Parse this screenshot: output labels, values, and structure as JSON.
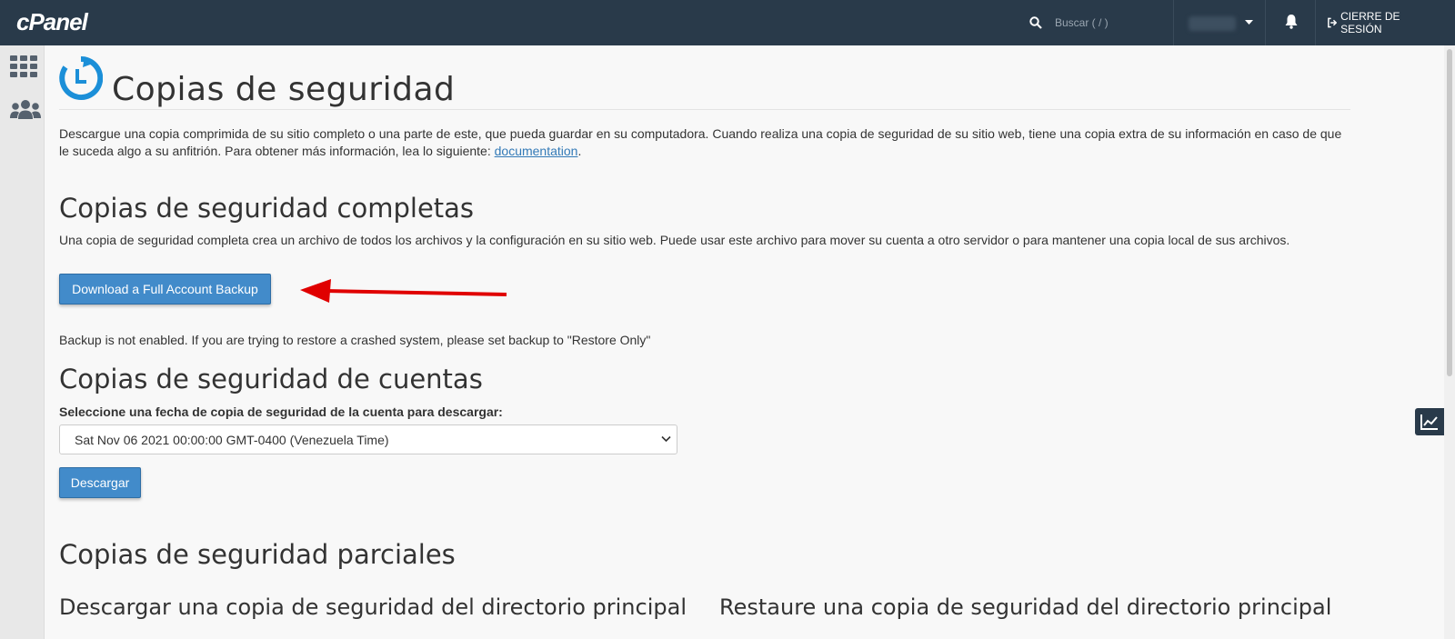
{
  "topbar": {
    "logo": "cPanel",
    "search_placeholder": "Buscar ( / )",
    "logout_label": "CIERRE DE SESIÓN"
  },
  "page": {
    "title": "Copias de seguridad",
    "intro_text": "Descargue una copia comprimida de su sitio completo o una parte de este, que pueda guardar en su computadora. Cuando realiza una copia de seguridad de su sitio web, tiene una copia extra de su información en caso de que le suceda algo a su anfitrión. Para obtener más información, lea lo siguiente: ",
    "intro_link": "documentation",
    "intro_end": "."
  },
  "full_backups": {
    "heading": "Copias de seguridad completas",
    "description": "Una copia de seguridad completa crea un archivo de todos los archivos y la configuración en su sitio web. Puede usar este archivo para mover su cuenta a otro servidor o para mantener una copia local de sus archivos.",
    "button_label": "Download a Full Account Backup",
    "notice": "Backup is not enabled. If you are trying to restore a crashed system, please set backup to \"Restore Only\""
  },
  "account_backups": {
    "heading": "Copias de seguridad de cuentas",
    "select_label": "Seleccione una fecha de copia de seguridad de la cuenta para descargar:",
    "selected_date": "Sat Nov 06 2021 00:00:00 GMT-0400 (Venezuela Time)",
    "download_label": "Descargar"
  },
  "partial_backups": {
    "heading": "Copias de seguridad parciales",
    "download_home_heading": "Descargar una copia de seguridad del directorio principal",
    "restore_home_heading": "Restaure una copia de seguridad del directorio principal"
  },
  "colors": {
    "topbar": "#293a4a",
    "primary_button": "#428bca",
    "link": "#337ab7",
    "annotation_arrow": "#e00000",
    "page_icon": "#1b8fd8"
  },
  "icons": [
    "search-icon",
    "user-caret-icon",
    "bell-icon",
    "logout-icon",
    "grid-icon",
    "users-icon",
    "backup-clock-icon",
    "chevron-down-icon",
    "stats-icon",
    "arrow-annotation"
  ]
}
